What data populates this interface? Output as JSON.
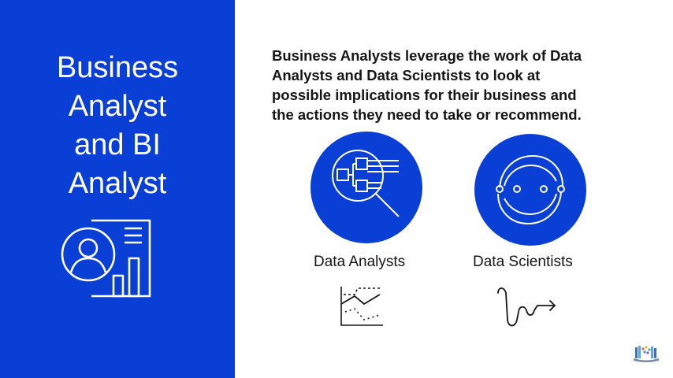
{
  "slide": {
    "title_lines": [
      "Business",
      "Analyst",
      "and BI",
      "Analyst"
    ],
    "description_lines": [
      "Business Analysts leverage the work of Data",
      "Analysts and Data Scientists to look at",
      "possible implications for their business and",
      "the actions they need to take or recommend."
    ]
  },
  "roles": [
    {
      "label": "Data Analysts",
      "icon": "magnifier-flowchart-icon",
      "sub_icon": "line-chart-icon"
    },
    {
      "label": "Data Scientists",
      "icon": "cycle-arrows-icon",
      "sub_icon": "squiggle-arrow-icon"
    }
  ],
  "icons": {
    "left_panel": "profile-report-icon",
    "corner": "library-logo-icon"
  },
  "colors": {
    "brand_blue": "#0a3fd6",
    "text": "#161616",
    "background": "#ffffff"
  }
}
